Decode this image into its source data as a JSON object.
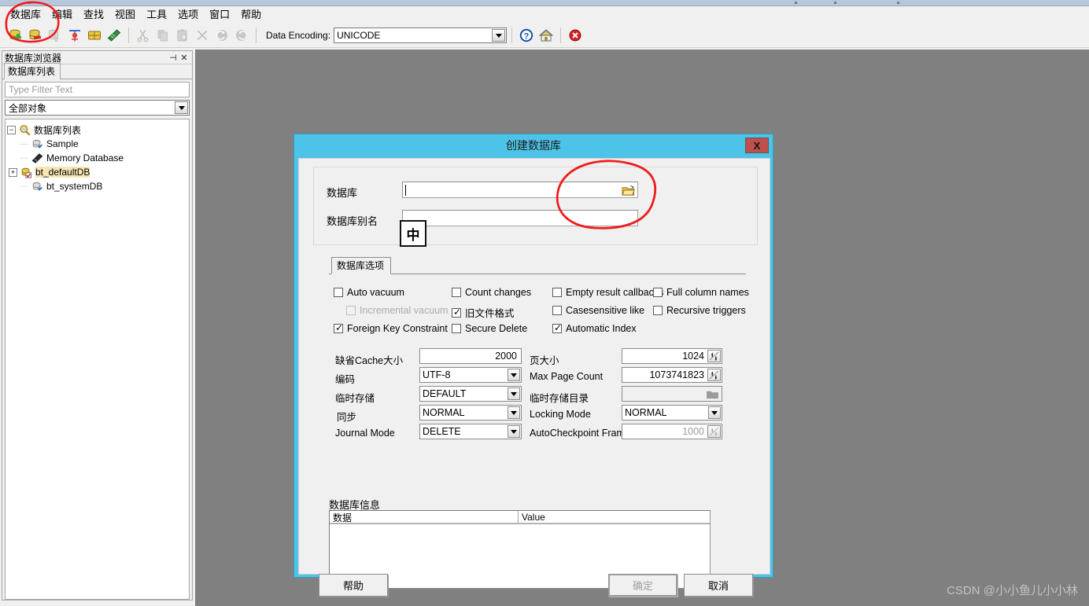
{
  "app": {
    "menus": [
      "数据库",
      "编辑",
      "查找",
      "视图",
      "工具",
      "选项",
      "窗口",
      "帮助"
    ],
    "toolbar": {
      "encoding_label": "Data Encoding:",
      "encoding_value": "UNICODE",
      "icons": [
        "new-database-icon",
        "remove-database-icon",
        "save-database-icon",
        "execute-sql-icon",
        "table-icon",
        "memory-icon",
        "cut-icon",
        "copy-icon",
        "paste-icon",
        "delete-icon",
        "undo-icon",
        "redo-icon",
        "help-icon",
        "home-icon",
        "close-icon"
      ]
    }
  },
  "sidebar": {
    "title": "数据库浏览器",
    "pin_icon": "pin-icon",
    "close_icon": "close-icon",
    "tab_label": "数据库列表",
    "filter_placeholder": "Type Filter Text",
    "object_filter_value": "全部对象",
    "tree": {
      "root_label": "数据库列表",
      "root_icon": "magnifier-icon",
      "children": [
        {
          "label": "Sample",
          "icon": "database-icon",
          "expandable": false,
          "selected": false
        },
        {
          "label": "Memory Database",
          "icon": "memory-chip-icon",
          "expandable": false,
          "selected": false
        },
        {
          "label": "bt_defaultDB",
          "icon": "database-open-icon",
          "expandable": true,
          "selected": true
        },
        {
          "label": "bt_systemDB",
          "icon": "database-icon",
          "expandable": false,
          "selected": false
        }
      ]
    }
  },
  "dialog": {
    "title": "创建数据库",
    "close_label": "X",
    "fields": {
      "db_label": "数据库",
      "db_value": "",
      "db_browse_icon": "folder-open-icon",
      "alias_label": "数据库别名",
      "alias_value": ""
    },
    "ime_indicator": "中",
    "options_tab": "数据库选项",
    "checkboxes": [
      {
        "label": "Auto vacuum",
        "checked": false,
        "disabled": false
      },
      {
        "label": "Incremental vacuum",
        "checked": false,
        "disabled": true
      },
      {
        "label": "Foreign Key Constraint",
        "checked": true,
        "disabled": false
      },
      {
        "label": "Count changes",
        "checked": false,
        "disabled": false
      },
      {
        "label": "旧文件格式",
        "checked": true,
        "disabled": false
      },
      {
        "label": "Secure Delete",
        "checked": false,
        "disabled": false
      },
      {
        "label": "Empty result callbacks",
        "checked": false,
        "disabled": false
      },
      {
        "label": "Casesensitive like",
        "checked": false,
        "disabled": false
      },
      {
        "label": "Automatic Index",
        "checked": true,
        "disabled": false
      },
      {
        "label": "Full column names",
        "checked": false,
        "disabled": false
      },
      {
        "label": "Recursive triggers",
        "checked": false,
        "disabled": false
      }
    ],
    "left_fields": [
      {
        "label": "缺省Cache大小",
        "value": "2000",
        "type": "number"
      },
      {
        "label": "编码",
        "value": "UTF-8",
        "type": "combo"
      },
      {
        "label": "临时存储",
        "value": "DEFAULT",
        "type": "combo"
      },
      {
        "label": "同步",
        "value": "NORMAL",
        "type": "combo"
      },
      {
        "label": "Journal Mode",
        "value": "DELETE",
        "type": "combo"
      }
    ],
    "right_fields": [
      {
        "label": "页大小",
        "value": "1024",
        "type": "spinner"
      },
      {
        "label": "Max Page Count",
        "value": "1073741823",
        "type": "spinner"
      },
      {
        "label": "临时存储目录",
        "value": "",
        "type": "dirpicker"
      },
      {
        "label": "Locking Mode",
        "value": "NORMAL",
        "type": "combo"
      },
      {
        "label": "AutoCheckpoint Frames",
        "value": "1000",
        "type": "spinner-disabled"
      }
    ],
    "dbinfo": {
      "caption": "数据库信息",
      "columns": [
        "数据",
        "Value"
      ],
      "rows": []
    },
    "buttons": {
      "help": "帮助",
      "ok": "确定",
      "cancel": "取消"
    }
  },
  "watermark": "CSDN @小小鱼儿小小林",
  "colors": {
    "dialog_frame": "#4ec3e8",
    "mdi_background": "#808080",
    "annotation": "#f01c1c",
    "close_button": "#c0504d"
  }
}
